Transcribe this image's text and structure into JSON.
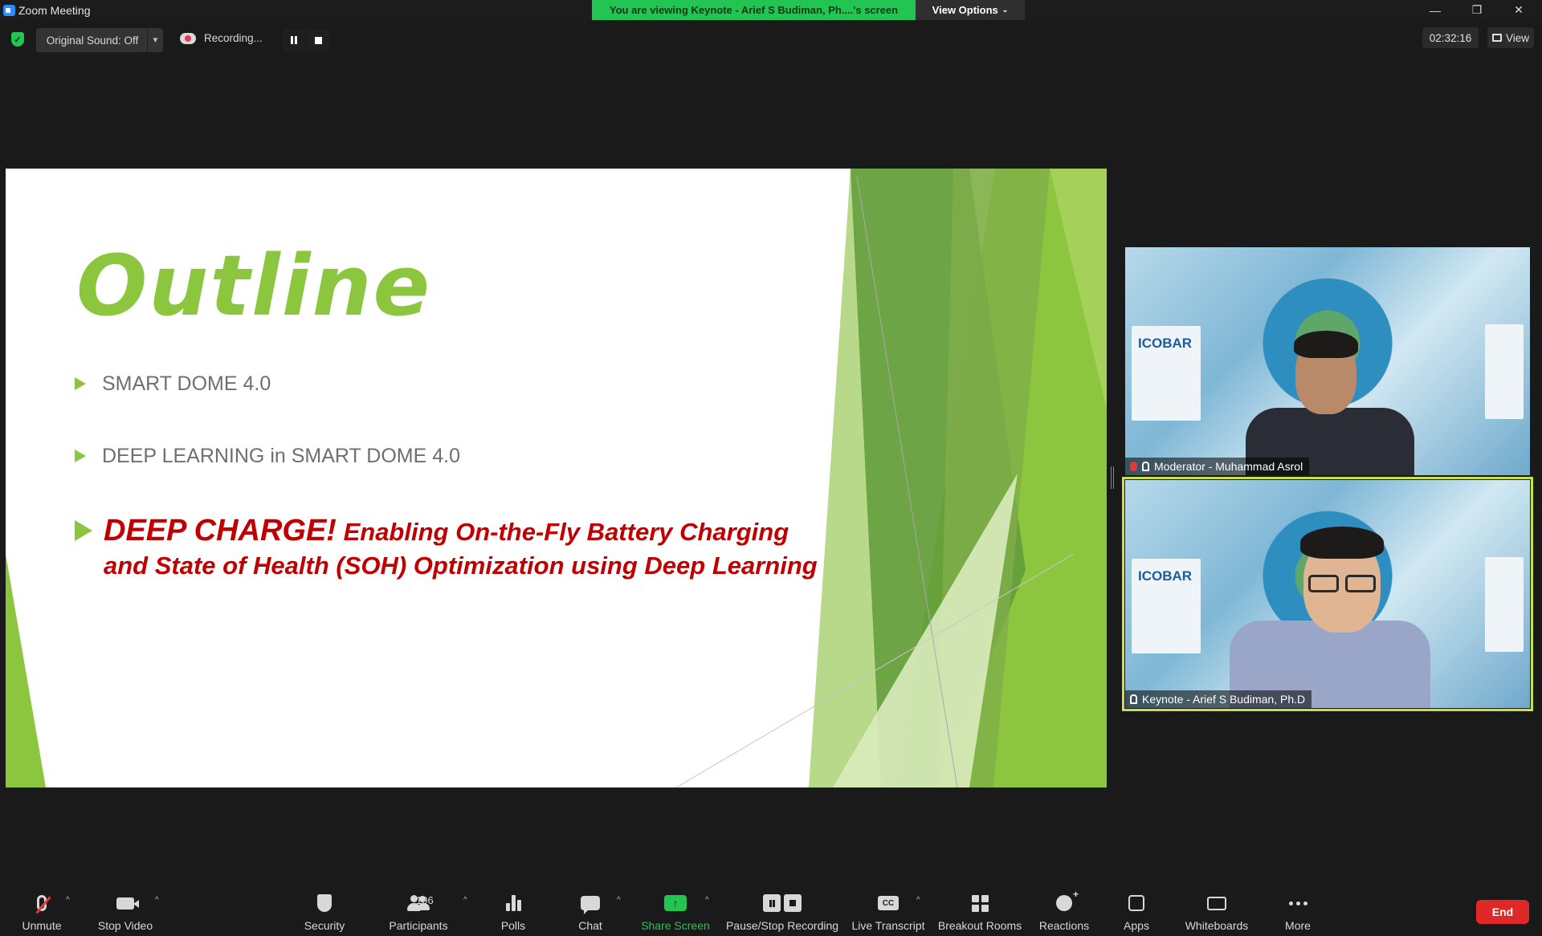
{
  "window": {
    "title": "Zoom Meeting",
    "viewing_banner": "You are viewing Keynote - Arief S Budiman, Ph....'s screen",
    "view_options": "View Options",
    "controls": {
      "minimize": "—",
      "restore": "❐",
      "close": "✕"
    }
  },
  "topbar": {
    "original_sound": "Original Sound: Off",
    "recording": "Recording...",
    "timer": "02:32:16",
    "view_label": "View"
  },
  "slide": {
    "title": "Outline",
    "bullets": [
      "SMART DOME 4.0",
      "DEEP LEARNING in SMART DOME 4.0"
    ],
    "bullet3_lead": "DEEP CHARGE!",
    "bullet3_rest": " Enabling On-the-Fly Battery Charging and State of Health (SOH) Optimization using Deep Learning"
  },
  "videos": [
    {
      "name": "Moderator - Muhammad Asrol",
      "muted": true,
      "logo": "ICOBAR"
    },
    {
      "name": "Keynote - Arief S Budiman, Ph.D",
      "muted": false,
      "logo": "ICOBAR",
      "active_speaker": true
    }
  ],
  "toolbar": {
    "unmute": "Unmute",
    "stop_video": "Stop Video",
    "security": "Security",
    "participants": "Participants",
    "participant_count": "196",
    "polls": "Polls",
    "chat": "Chat",
    "share_screen": "Share Screen",
    "pause_stop_recording": "Pause/Stop Recording",
    "live_transcript": "Live Transcript",
    "live_transcript_icon": "CC",
    "breakout_rooms": "Breakout Rooms",
    "reactions": "Reactions",
    "apps": "Apps",
    "whiteboards": "Whiteboards",
    "more": "More",
    "end": "End"
  },
  "colors": {
    "accent_green": "#23c552",
    "slide_green": "#8cc63f",
    "slide_red": "#c00000",
    "end_red": "#e02828",
    "active_border": "#c8e04a"
  }
}
